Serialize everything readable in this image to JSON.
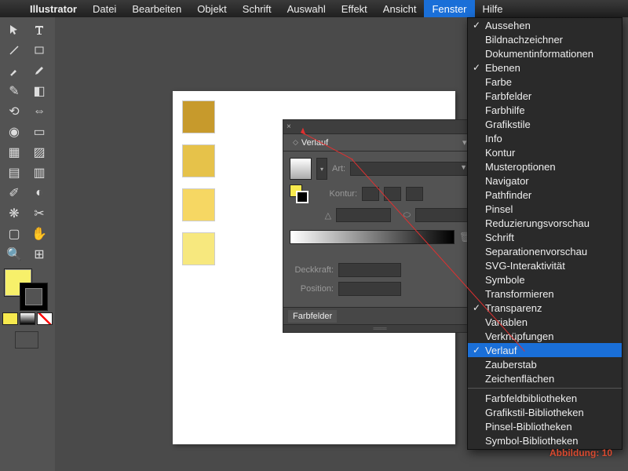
{
  "menubar": {
    "app": "Illustrator",
    "items": [
      "Datei",
      "Bearbeiten",
      "Objekt",
      "Schrift",
      "Auswahl",
      "Effekt",
      "Ansicht",
      "Fenster",
      "Hilfe"
    ],
    "active": "Fenster"
  },
  "dropdown": {
    "groups": [
      [
        {
          "label": "Aussehen",
          "checked": true
        },
        {
          "label": "Bildnachzeichner",
          "checked": false
        },
        {
          "label": "Dokumentinformationen",
          "checked": false
        },
        {
          "label": "Ebenen",
          "checked": true
        },
        {
          "label": "Farbe",
          "checked": false
        },
        {
          "label": "Farbfelder",
          "checked": false
        },
        {
          "label": "Farbhilfe",
          "checked": false
        },
        {
          "label": "Grafikstile",
          "checked": false
        },
        {
          "label": "Info",
          "checked": false
        },
        {
          "label": "Kontur",
          "checked": false
        },
        {
          "label": "Musteroptionen",
          "checked": false
        },
        {
          "label": "Navigator",
          "checked": false
        },
        {
          "label": "Pathfinder",
          "checked": false
        },
        {
          "label": "Pinsel",
          "checked": false
        },
        {
          "label": "Reduzierungsvorschau",
          "checked": false
        },
        {
          "label": "Schrift",
          "checked": false
        },
        {
          "label": "Separationenvorschau",
          "checked": false
        },
        {
          "label": "SVG-Interaktivität",
          "checked": false
        },
        {
          "label": "Symbole",
          "checked": false
        },
        {
          "label": "Transformieren",
          "checked": false
        },
        {
          "label": "Transparenz",
          "checked": true
        },
        {
          "label": "Variablen",
          "checked": false
        },
        {
          "label": "Verknüpfungen",
          "checked": false
        },
        {
          "label": "Verlauf",
          "checked": true,
          "hl": true
        },
        {
          "label": "Zauberstab",
          "checked": false
        },
        {
          "label": "Zeichenflächen",
          "checked": false
        }
      ],
      [
        {
          "label": "Farbfeldbibliotheken",
          "checked": false
        },
        {
          "label": "Grafikstil-Bibliotheken",
          "checked": false
        },
        {
          "label": "Pinsel-Bibliotheken",
          "checked": false
        },
        {
          "label": "Symbol-Bibliotheken",
          "checked": false
        }
      ]
    ]
  },
  "panel": {
    "tab1": "Verlauf",
    "tab2": "Farbfelder",
    "labels": {
      "art": "Art:",
      "kontur": "Kontur:",
      "deckkraft": "Deckkraft:",
      "position": "Position:"
    }
  },
  "swatch_colors": [
    "#c79a2c",
    "#e6c24a",
    "#f6d763",
    "#f7e87e"
  ],
  "caption": "Abbildung: 10"
}
